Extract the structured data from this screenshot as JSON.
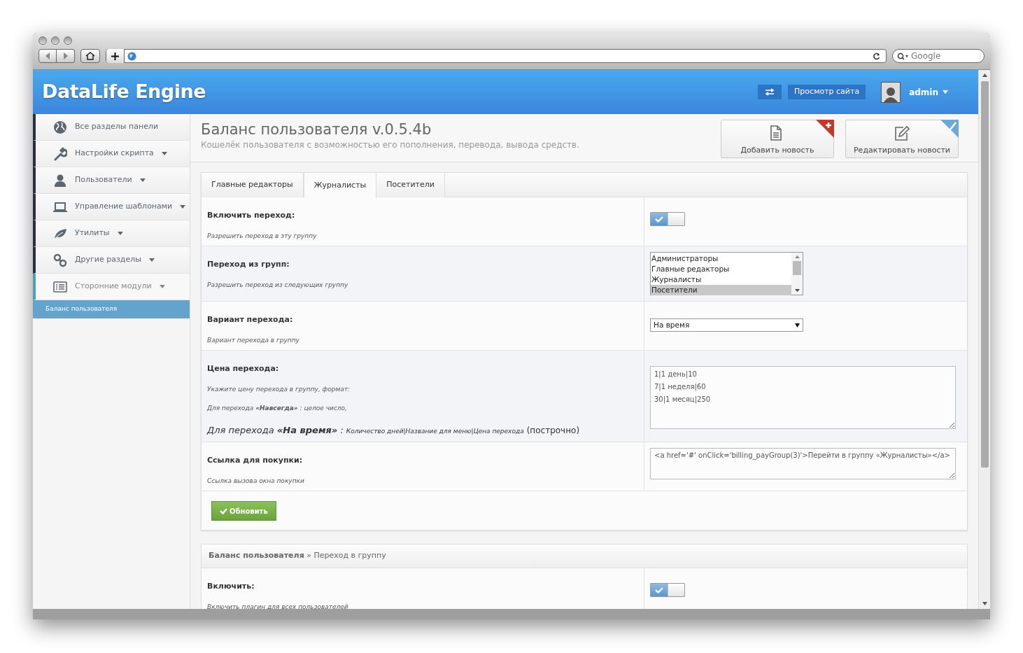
{
  "browser": {
    "search_placeholder": "Google"
  },
  "header": {
    "logo": "DataLife Engine",
    "site_button": "Просмотр сайта",
    "user": "admin"
  },
  "sidebar": {
    "items": [
      {
        "label": "Все разделы панели",
        "has_menu": false,
        "selected": false
      },
      {
        "label": "Настройки скрипта",
        "has_menu": true,
        "selected": false
      },
      {
        "label": "Пользователи",
        "has_menu": true,
        "selected": false
      },
      {
        "label": "Управление шаблонами",
        "has_menu": true,
        "selected": false
      },
      {
        "label": "Утилиты",
        "has_menu": true,
        "selected": false
      },
      {
        "label": "Другие разделы",
        "has_menu": true,
        "selected": false
      },
      {
        "label": "Сторонние модули",
        "has_menu": true,
        "selected": true,
        "children": [
          {
            "label": "Баланс пользователя",
            "selected": true
          }
        ]
      }
    ]
  },
  "page": {
    "title": "Баланс пользователя v.0.5.4b",
    "subtitle": "Кошелёк пользователя с возможностью его пополнения, перевода, вывода средств.",
    "actions": [
      {
        "kind": "add",
        "label": "Добавить новость"
      },
      {
        "kind": "edit",
        "label": "Редактировать новости"
      }
    ]
  },
  "settings_panel": {
    "tabs": [
      {
        "label": "Главные редакторы",
        "selected": false
      },
      {
        "label": "Журналисты",
        "selected": true
      },
      {
        "label": "Посетители",
        "selected": false
      }
    ],
    "rows": [
      {
        "kind": "toggle",
        "label": "Включить переход:",
        "hints": [
          "Разрешить переход в эту группу"
        ],
        "on": true
      },
      {
        "kind": "listbox",
        "label": "Переход из групп:",
        "hints": [
          "Разрешить переход из следующих группу"
        ],
        "options": [
          {
            "label": "Администраторы",
            "selected": false
          },
          {
            "label": "Главные редакторы",
            "selected": false
          },
          {
            "label": "Журналисты",
            "selected": false
          },
          {
            "label": "Посетители",
            "selected": true
          }
        ]
      },
      {
        "kind": "select",
        "label": "Вариант перехода:",
        "hints": [
          "Вариант перехода в группу"
        ],
        "value": "На время"
      },
      {
        "kind": "textarea",
        "label": "Цена перехода:",
        "hints": [
          "Укажите цену перехода в группу, формат:",
          "Для перехода **«Навсегда»** : целое число,"
        ],
        "note": {
          "lead": "Для перехода **«На время»** :",
          "detail": "Количество дней|Название для меню|Цена перехода",
          "tail": "(построчно)"
        },
        "value": "1|1 день|10\n7|1 неделя|60\n30|1 месяц|250"
      },
      {
        "kind": "code",
        "label": "Ссылка для покупки:",
        "hints": [
          "Ссылка вызова окна покупки"
        ],
        "value": "<a href='#' onClick='billing_payGroup(3)'>Перейти в группу «Журналисты»</a>"
      }
    ],
    "submit": "Обновить"
  },
  "second_panel": {
    "title": "**Баланс пользователя** » Переход в группу",
    "rows": [
      {
        "kind": "toggle",
        "label": "Включить:",
        "hints": [
          "Включить плагин для всех пользователей"
        ],
        "on": true
      }
    ]
  }
}
